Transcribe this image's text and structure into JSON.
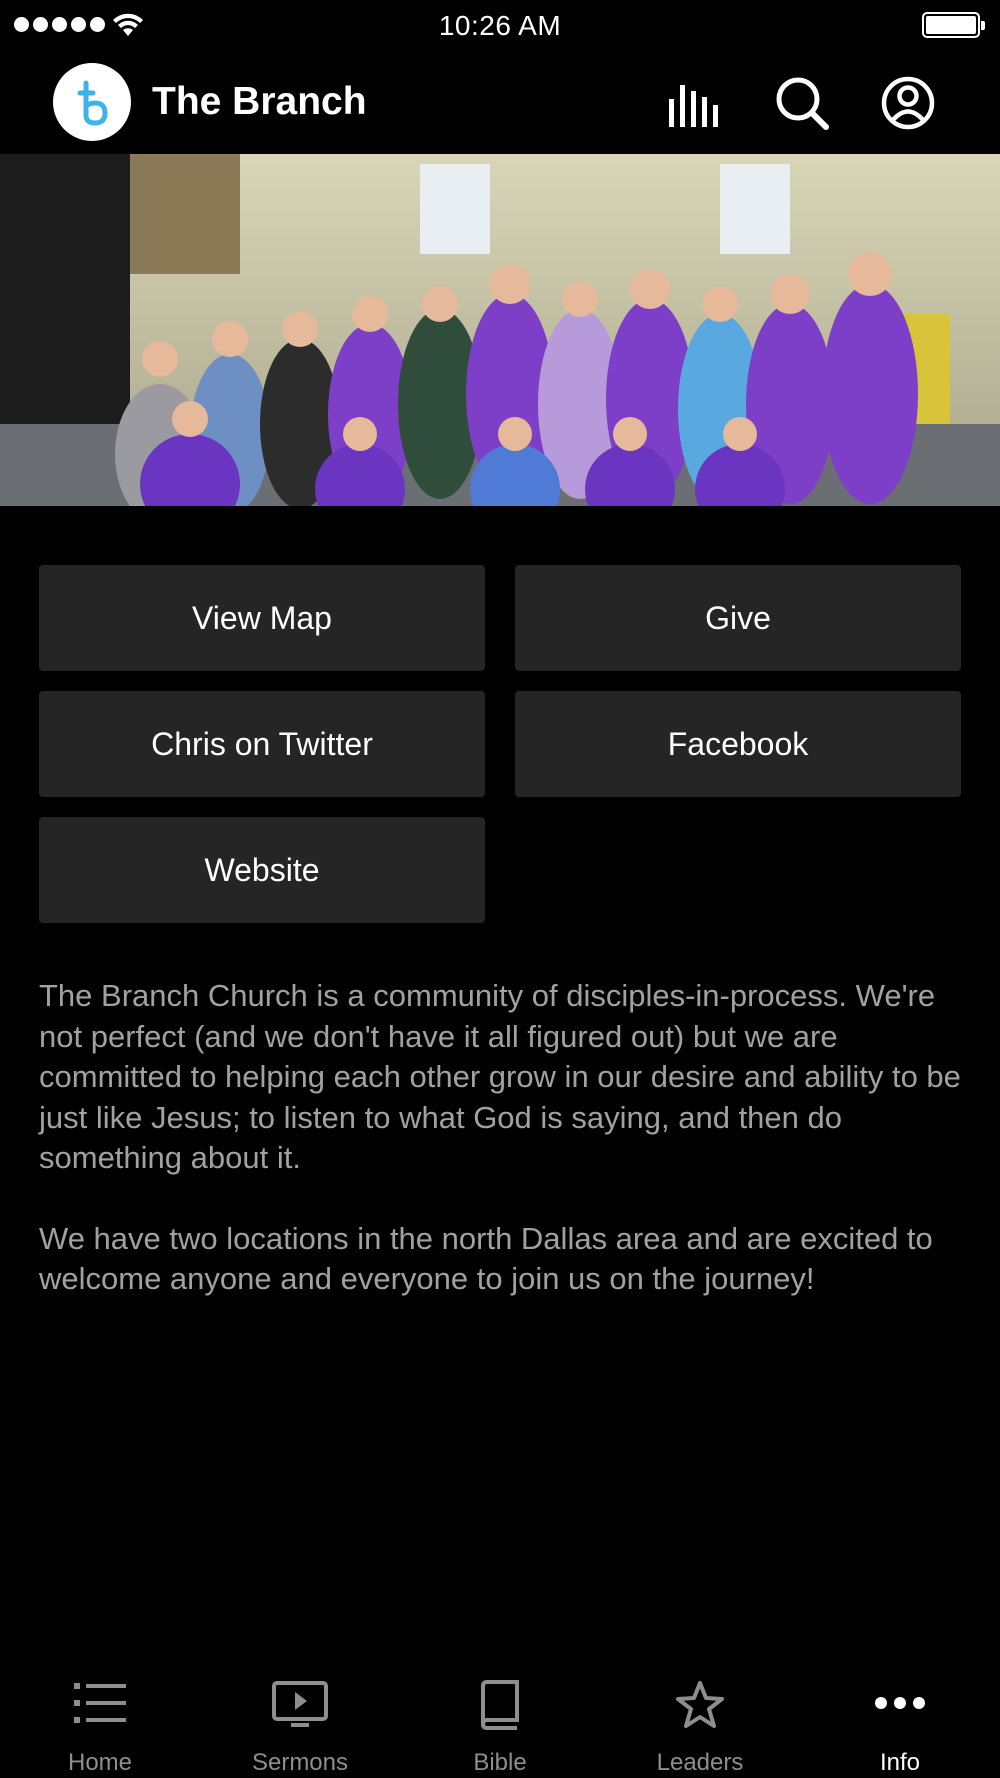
{
  "status_bar": {
    "time": "10:26 AM"
  },
  "header": {
    "title": "The Branch",
    "logo_icon": "branch-b-logo-icon",
    "icons": [
      "audio-bars-icon",
      "search-icon",
      "account-icon"
    ]
  },
  "hero": {
    "alt": "Group photo of church volunteers"
  },
  "buttons": {
    "view_map": "View Map",
    "give": "Give",
    "twitter": "Chris on Twitter",
    "facebook": "Facebook",
    "website": "Website"
  },
  "description": {
    "paragraph_1": "The Branch Church is a community of disciples-in-process.  We're not perfect (and we don't have it all figured out) but we are committed to helping each other grow in our desire and ability to be just like Jesus; to listen to what God is saying, and then do something about it.",
    "paragraph_2": "We have two locations in the north Dallas area and are excited to welcome anyone and everyone to join us on the journey!"
  },
  "tab_bar": {
    "tabs": [
      {
        "label": "Home",
        "icon": "list-icon"
      },
      {
        "label": "Sermons",
        "icon": "play-screen-icon"
      },
      {
        "label": "Bible",
        "icon": "book-icon"
      },
      {
        "label": "Leaders",
        "icon": "star-icon"
      },
      {
        "label": "Info",
        "icon": "more-dots-icon",
        "active": true
      }
    ]
  },
  "colors": {
    "background": "#000000",
    "button_bg": "#252525",
    "text_muted": "#a1a1a1",
    "logo_accent": "#3fb2e8",
    "tab_inactive": "#8e8e8e"
  }
}
